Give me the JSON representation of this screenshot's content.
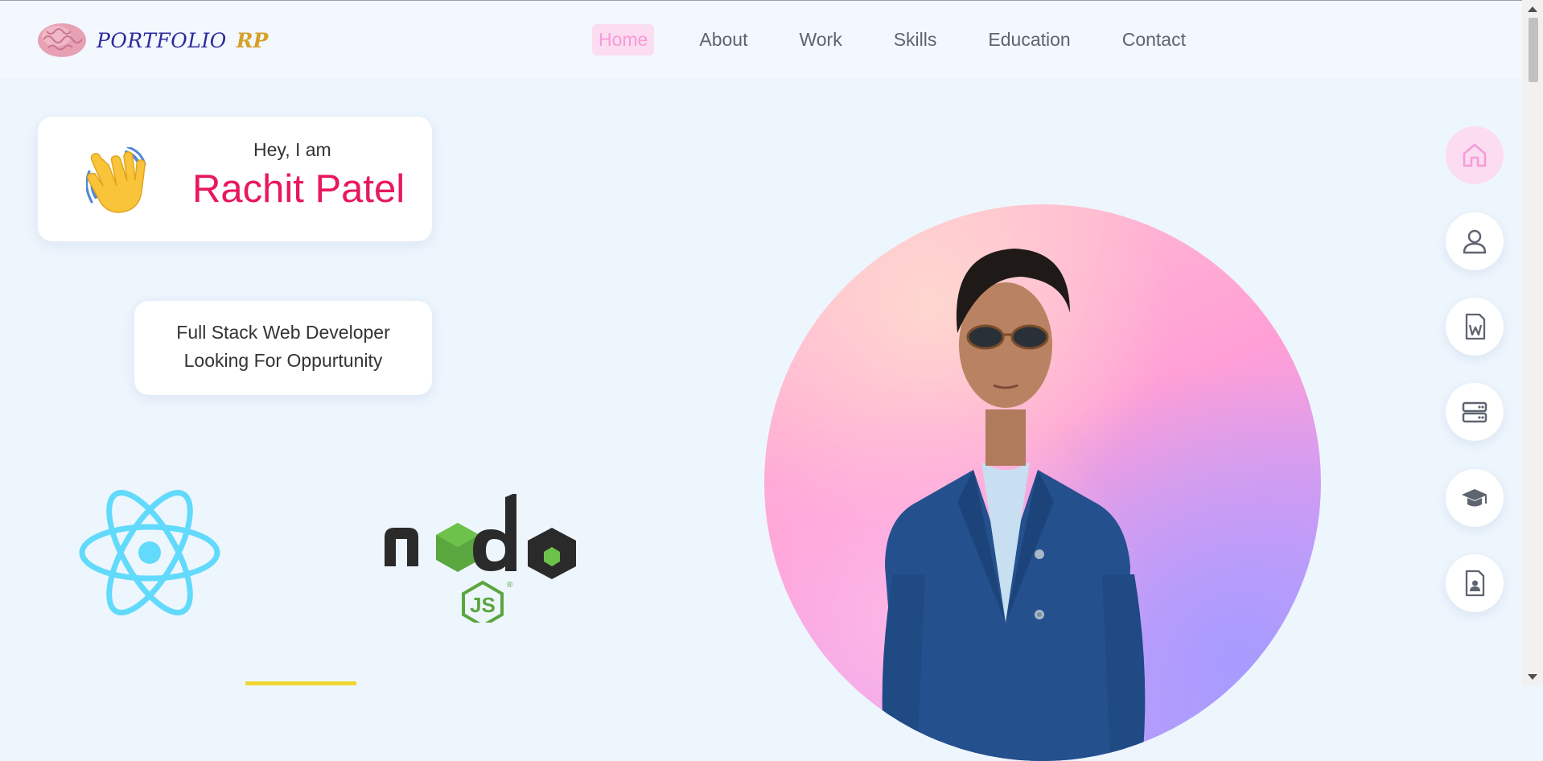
{
  "logo": {
    "text_main": "PORTFOLIO",
    "text_accent": "RP",
    "icon": "brain-icon"
  },
  "nav": {
    "items": [
      {
        "label": "Home",
        "active": true
      },
      {
        "label": "About"
      },
      {
        "label": "Work"
      },
      {
        "label": "Skills"
      },
      {
        "label": "Education"
      },
      {
        "label": "Contact"
      }
    ]
  },
  "hero": {
    "greeting": "Hey, I am",
    "name": "Rachit Patel",
    "role_line1": "Full Stack Web Developer",
    "role_line2": "Looking For Oppurtunity",
    "wave_icon": "waving-hand-icon"
  },
  "tech_logos": [
    "react-logo",
    "nodejs-logo"
  ],
  "side_nav": [
    "home-icon",
    "user-icon",
    "word-document-icon",
    "server-icon",
    "graduation-cap-icon",
    "contact-file-icon"
  ],
  "colors": {
    "accent_pink": "#e8185c",
    "active_bg": "#fbdcf1",
    "active_fg": "#f79bd7",
    "background": "#eef6fd"
  }
}
